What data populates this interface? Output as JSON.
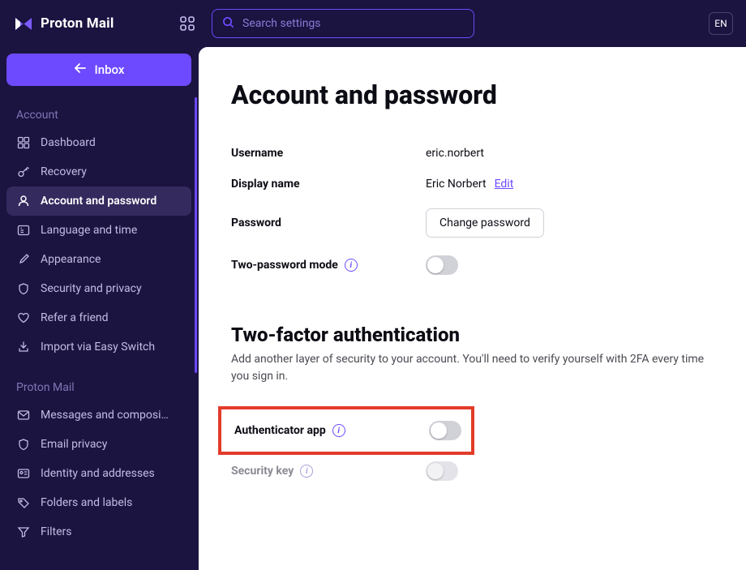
{
  "brand": "Proton Mail",
  "lang_btn": "EN",
  "search": {
    "placeholder": "Search settings"
  },
  "inbox_btn": "Inbox",
  "sidebar": {
    "section_account": "Account",
    "section_proton_mail": "Proton Mail",
    "account_items": [
      {
        "icon": "dashboard",
        "label": "Dashboard"
      },
      {
        "icon": "recovery",
        "label": "Recovery"
      },
      {
        "icon": "user",
        "label": "Account and password"
      },
      {
        "icon": "globe",
        "label": "Language and time"
      },
      {
        "icon": "brush",
        "label": "Appearance"
      },
      {
        "icon": "shield",
        "label": "Security and privacy"
      },
      {
        "icon": "heart",
        "label": "Refer a friend"
      },
      {
        "icon": "import",
        "label": "Import via Easy Switch"
      }
    ],
    "mail_items": [
      {
        "icon": "envelope",
        "label": "Messages and composi…"
      },
      {
        "icon": "shield",
        "label": "Email privacy"
      },
      {
        "icon": "id",
        "label": "Identity and addresses"
      },
      {
        "icon": "tag",
        "label": "Folders and labels"
      },
      {
        "icon": "filter",
        "label": "Filters"
      }
    ]
  },
  "page": {
    "title": "Account and password",
    "username_label": "Username",
    "username_value": "eric.norbert",
    "display_name_label": "Display name",
    "display_name_value": "Eric Norbert",
    "edit_label": "Edit",
    "password_label": "Password",
    "change_password_btn": "Change password",
    "two_password_label": "Two-password mode",
    "tfa_heading": "Two-factor authentication",
    "tfa_desc": "Add another layer of security to your account. You'll need to verify yourself with 2FA every time you sign in.",
    "authenticator_label": "Authenticator app",
    "security_key_label": "Security key"
  }
}
